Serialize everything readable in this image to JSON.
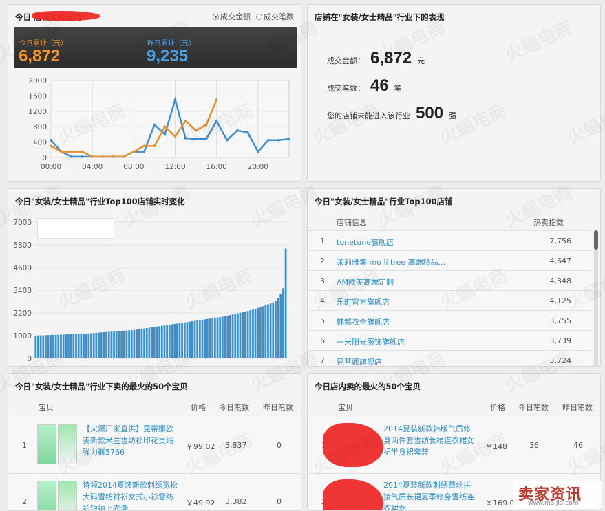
{
  "realtime": {
    "title": "今日                  店铺实时走向",
    "radio_amount": "成交金额",
    "radio_count": "成交笔数",
    "today_label": "今日累计（元）",
    "today_value": "6,872",
    "yesterday_label": "昨日累计（元）",
    "yesterday_value": "9,235",
    "colors": {
      "today": "#e8902a",
      "yesterday": "#3b8ed4"
    }
  },
  "chart_data": [
    {
      "type": "line",
      "x": [
        0,
        1,
        2,
        3,
        4,
        5,
        6,
        7,
        8,
        9,
        10,
        11,
        12,
        13,
        14,
        15,
        16,
        17,
        18,
        19,
        20,
        21,
        22,
        23
      ],
      "xtick_labels": [
        "00:00",
        "04:00",
        "08:00",
        "12:00",
        "16:00",
        "20:00"
      ],
      "ylim": [
        0,
        2000
      ],
      "ytick_labels": [
        "0",
        "400",
        "800",
        "1200",
        "1600",
        "2000"
      ],
      "series": [
        {
          "values": [
            300,
            150,
            150,
            150,
            20,
            20,
            20,
            20,
            150,
            300,
            300,
            800,
            550,
            950,
            700,
            850,
            1500
          ]
        },
        {
          "values": [
            450,
            150,
            20,
            20,
            20,
            20,
            20,
            20,
            150,
            150,
            850,
            600,
            1500,
            500,
            480,
            480,
            950,
            450,
            700,
            650,
            150,
            450,
            450,
            480
          ]
        }
      ]
    },
    {
      "type": "bar",
      "ylim": [
        0,
        7000
      ],
      "ytick_labels": [
        "0",
        "1000",
        "2200",
        "3400",
        "4600",
        "5800",
        "7000"
      ],
      "values": [
        1000,
        1010,
        1015,
        1020,
        1025,
        1030,
        1035,
        1040,
        1045,
        1050,
        1055,
        1060,
        1065,
        1070,
        1075,
        1080,
        1085,
        1090,
        1095,
        1100,
        1110,
        1120,
        1130,
        1140,
        1150,
        1160,
        1170,
        1180,
        1190,
        1200,
        1210,
        1220,
        1230,
        1240,
        1250,
        1260,
        1270,
        1280,
        1290,
        1300,
        1320,
        1340,
        1360,
        1380,
        1400,
        1420,
        1440,
        1460,
        1480,
        1500,
        1520,
        1540,
        1560,
        1580,
        1600,
        1620,
        1640,
        1660,
        1680,
        1700,
        1720,
        1740,
        1760,
        1780,
        1800,
        1820,
        1840,
        1860,
        1880,
        1900,
        1920,
        1940,
        1960,
        1980,
        2000,
        2030,
        2060,
        2090,
        2120,
        2150,
        2180,
        2210,
        2240,
        2270,
        2300,
        2340,
        2380,
        2420,
        2460,
        2500,
        2550,
        2600,
        2650,
        2700,
        2760,
        2830,
        3000,
        3200,
        3500,
        5600
      ]
    }
  ],
  "industry": {
    "title": "店铺在\"女装/女士精品\"行业下的表现",
    "amount_label": "成交金额：",
    "amount_value": "6,872",
    "amount_unit": "元",
    "count_label": "成交笔数：",
    "count_value": "46",
    "count_unit": "笔",
    "rank_label": "您的店铺未能进入该行业",
    "rank_value": "500",
    "rank_unit": "强"
  },
  "top100_chart": {
    "title": "今日\"女装/女士精品\"行业Top100店铺实时变化"
  },
  "top100_list": {
    "title": "今日\"女装/女士精品\"行业Top100店铺",
    "col_shop": "店铺信息",
    "col_index": "热卖指数",
    "rows": [
      {
        "rank": "1",
        "name": "tunetune旗舰店",
        "index": "7,756"
      },
      {
        "rank": "2",
        "name": "茉莉雅集 mo li tree 高端精品...",
        "index": "4,647"
      },
      {
        "rank": "3",
        "name": "AM欧美高端定制",
        "index": "4,348"
      },
      {
        "rank": "4",
        "name": "乐町官方旗舰店",
        "index": "4,125"
      },
      {
        "rank": "5",
        "name": "韩都衣舍旗舰店",
        "index": "3,755"
      },
      {
        "rank": "6",
        "name": "一米阳光服饰旗舰店",
        "index": "3,739"
      },
      {
        "rank": "7",
        "name": "昆蒂娜旗舰店",
        "index": "3,724"
      }
    ]
  },
  "hot_products": {
    "title": "今日\"女装/女士精品\"行业下卖的最火的50个宝贝",
    "col_item": "宝贝",
    "col_price": "价格",
    "col_today": "今日笔数",
    "col_yesterday": "昨日笔数",
    "rows": [
      {
        "rank": "1",
        "name": "【火爆厂家直供】昆蒂娜欧美新款米兰雪纺衫印花贡缎弹力裤5766",
        "price": "￥99.02",
        "today": "3,837",
        "yesterday": "0"
      },
      {
        "rank": "2",
        "name": "诗领2014夏装新款刺绣宽松大码雪纺衬衫女式小衫雪纺衫短袖上衣潮",
        "price": "￥49.92",
        "today": "3,382",
        "yesterday": "0"
      }
    ]
  },
  "shop_products": {
    "title": "今日店内卖的最火的50个宝贝",
    "col_item": "宝贝",
    "col_price": "价格",
    "col_today": "今日笔数",
    "col_yesterday": "昨日笔数",
    "rows": [
      {
        "rank": "1",
        "name": "2014夏装新款韩版气质修身两件套雪纺长裙连衣裙女裙半身裙套装",
        "price": "￥148",
        "today": "36",
        "yesterday": "46"
      },
      {
        "rank": "2",
        "name": "2014夏装新款刺绣蕾丝拼接气质长裙夏季修身雪纺连衣裙女",
        "price": "￥169.03",
        "today": "5",
        "yesterday": "6"
      }
    ]
  },
  "watermark": "火蝠电商",
  "logo": {
    "text": "卖家资讯",
    "url": "www.maijia.com"
  }
}
